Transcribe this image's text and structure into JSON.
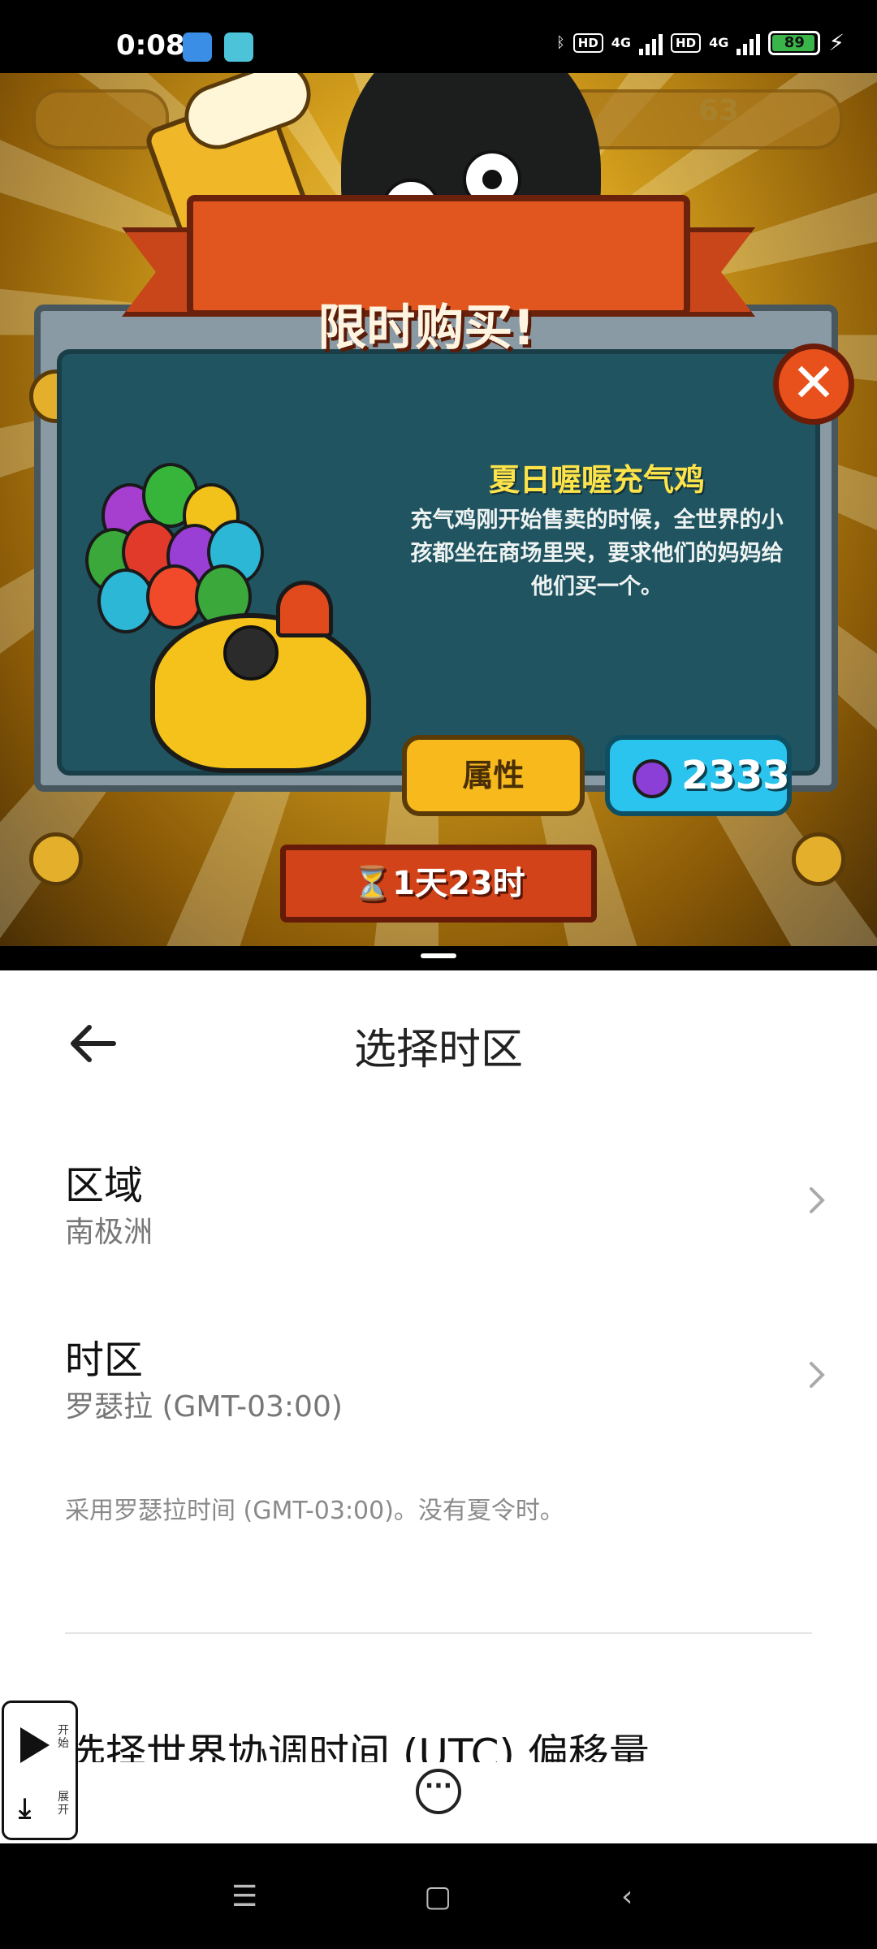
{
  "status_bar": {
    "time": "0:08",
    "battery": "89",
    "network": [
      "HD",
      "4G",
      "HD",
      "4G"
    ]
  },
  "game": {
    "hud_coins": "63",
    "banner_title": "限时购买!",
    "item_name": "夏日喔喔充气鸡",
    "item_description": "充气鸡刚开始售卖的时候，全世界的小孩都坐在商场里哭，要求他们的妈妈给他们买一个。",
    "attributes_button": "属性",
    "price": "2333",
    "timer": "⏳1天23时",
    "close_symbol": "✕"
  },
  "settings": {
    "title": "选择时区",
    "region_title": "区域",
    "region_value": "南极洲",
    "timezone_title": "时区",
    "timezone_value": "罗瑟拉 (GMT-03:00)",
    "note": "采用罗瑟拉时间 (GMT-03:00)。没有夏令时。",
    "utc_row_partial": "选择世界协调时间 (UTC) 偏移量"
  },
  "floating_control": {
    "start_label": "开始",
    "expand_label": "展开"
  },
  "colors": {
    "banner": "#e0561e",
    "item_name": "#fde34a",
    "attr_button": "#f7b91c",
    "price_button": "#2bc4ee",
    "dialog_inner": "#1f5460"
  },
  "icons": {
    "back": "back-arrow-icon",
    "chevron": "chevron-right-icon",
    "more": "more-icon",
    "nav": [
      "menu-icon",
      "home-icon",
      "back-icon"
    ]
  }
}
